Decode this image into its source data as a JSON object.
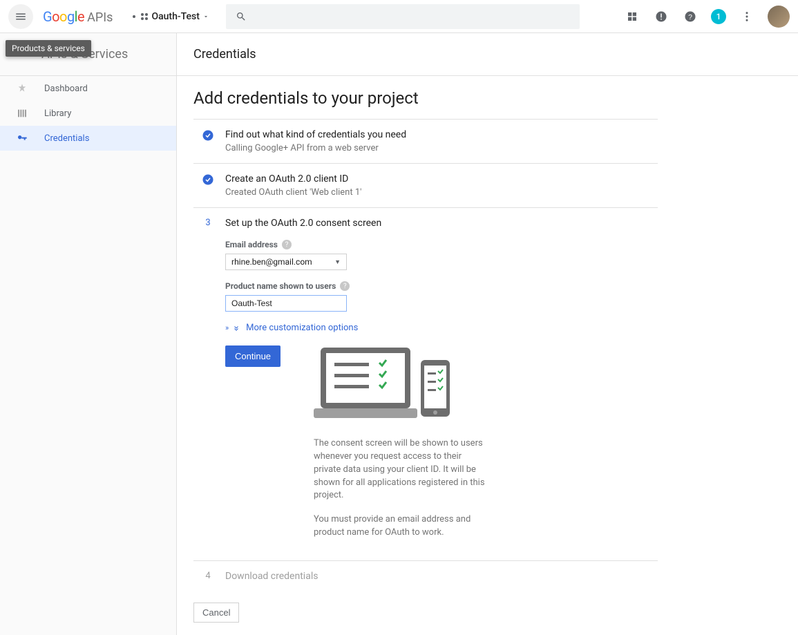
{
  "header": {
    "logo_prefix": "Google",
    "logo_suffix": "APIs",
    "project_name": "Oauth-Test",
    "search_placeholder": "",
    "tooltip": "Products & services",
    "notif_count": "1"
  },
  "sidebar": {
    "title": "APIs & Services",
    "items": [
      {
        "label": "Dashboard"
      },
      {
        "label": "Library"
      },
      {
        "label": "Credentials"
      }
    ]
  },
  "main": {
    "page_title": "Credentials",
    "heading": "Add credentials to your project",
    "steps": [
      {
        "title": "Find out what kind of credentials you need",
        "subtitle": "Calling Google+ API from a web server"
      },
      {
        "title": "Create an OAuth 2.0 client ID",
        "subtitle": "Created OAuth client 'Web client 1'"
      },
      {
        "num": "3",
        "title": "Set up the OAuth 2.0 consent screen"
      },
      {
        "num": "4",
        "title": "Download credentials"
      }
    ],
    "form": {
      "email_label": "Email address",
      "email_value": "rhine.ben@gmail.com",
      "product_label": "Product name shown to users",
      "product_value": "Oauth-Test",
      "more_options": "More customization options",
      "continue_label": "Continue",
      "info1": "The consent screen will be shown to users whenever you request access to their private data using your client ID. It will be shown for all applications registered in this project.",
      "info2": "You must provide an email address and product name for OAuth to work."
    },
    "cancel_label": "Cancel"
  }
}
